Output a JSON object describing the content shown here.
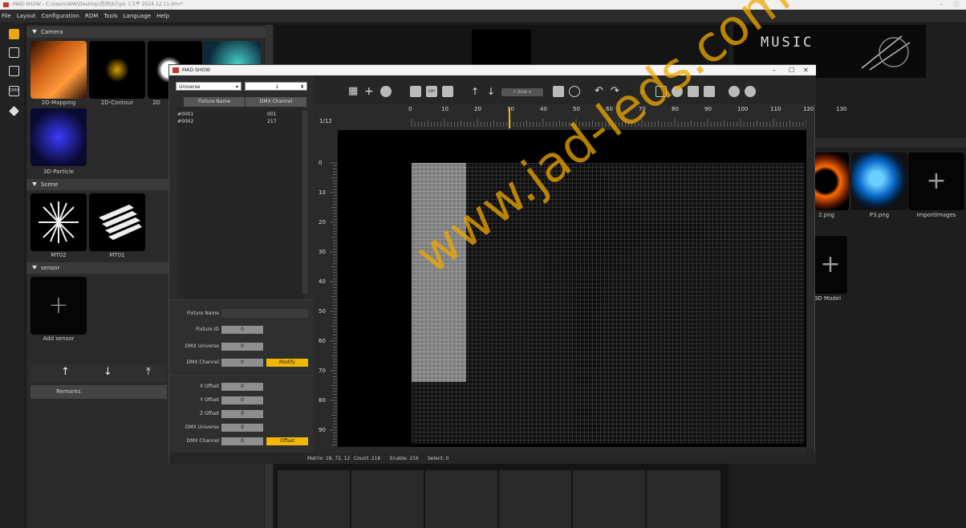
{
  "window": {
    "title": "MAD-SHOW - C:\\Users\\WW\\Desktop\\范例\\8方pic 1.5平 2024.12.11.dmr*",
    "min": "–",
    "close": "ⓘ"
  },
  "menu": [
    "File",
    "Layout",
    "Configuration",
    "RDM",
    "Tools",
    "Language",
    "Help"
  ],
  "library": {
    "camera_header": "Camera",
    "camera_items": [
      "2D-Mapping",
      "2D-Contour",
      "2D",
      "3D-Particle"
    ],
    "scene_header": "Scene",
    "scene_items": [
      "MT02",
      "MT01"
    ],
    "sensor_header": "sensor",
    "sensor_add": "Add sensor",
    "remarks": "Remarks",
    "tool_up": "↑",
    "tool_down": "↓",
    "tool_top": "⤒"
  },
  "right_panel": {
    "banner": "MUSIC",
    "images": [
      "2.png",
      "P3.png",
      "ImportImages"
    ],
    "model_label": "t 3D Model"
  },
  "dialog": {
    "title": "MAD-SHOW",
    "universe_select": "Universe",
    "universe_value": "1",
    "col_fixture_name": "Fixture Name",
    "col_dmx_channel": "DMX Channel",
    "fixtures": [
      {
        "name": "#0001",
        "channel": "001"
      },
      {
        "name": "#0002",
        "channel": "217"
      }
    ],
    "form1": {
      "fixture_name_label": "Fixture Name",
      "fixture_id_label": "Fixture ID",
      "fixture_id": "0",
      "dmx_universe_label": "DMX Universe",
      "dmx_universe": "0",
      "dmx_channel_label": "DMX Channel",
      "dmx_channel": "0",
      "modify": "Modify"
    },
    "form2": {
      "x_label": "X Offset",
      "x": "0",
      "y_label": "Y Offset",
      "y": "0",
      "z_label": "Z Offset",
      "z": "0",
      "dmx_universe_label": "DMX Universe",
      "dmx_universe": "0",
      "dmx_channel_label": "DMX Channel",
      "dmx_channel": "0",
      "offset": "Offset"
    },
    "page_label": "1/12",
    "list_toggle": "< 2List >",
    "ruler_top": [
      "0",
      "10",
      "20",
      "30",
      "40",
      "50",
      "60",
      "70",
      "80",
      "90",
      "100",
      "110",
      "120",
      "130"
    ],
    "ruler_left": [
      "0",
      "10",
      "20",
      "30",
      "40",
      "50",
      "60",
      "70",
      "80",
      "90"
    ],
    "status": {
      "matrix": "Matrix: 18, 72, 12",
      "count": "Count: 216",
      "enable": "Enable: 216",
      "select": "Select: 0"
    }
  },
  "watermark": "www.jad-leds.com"
}
